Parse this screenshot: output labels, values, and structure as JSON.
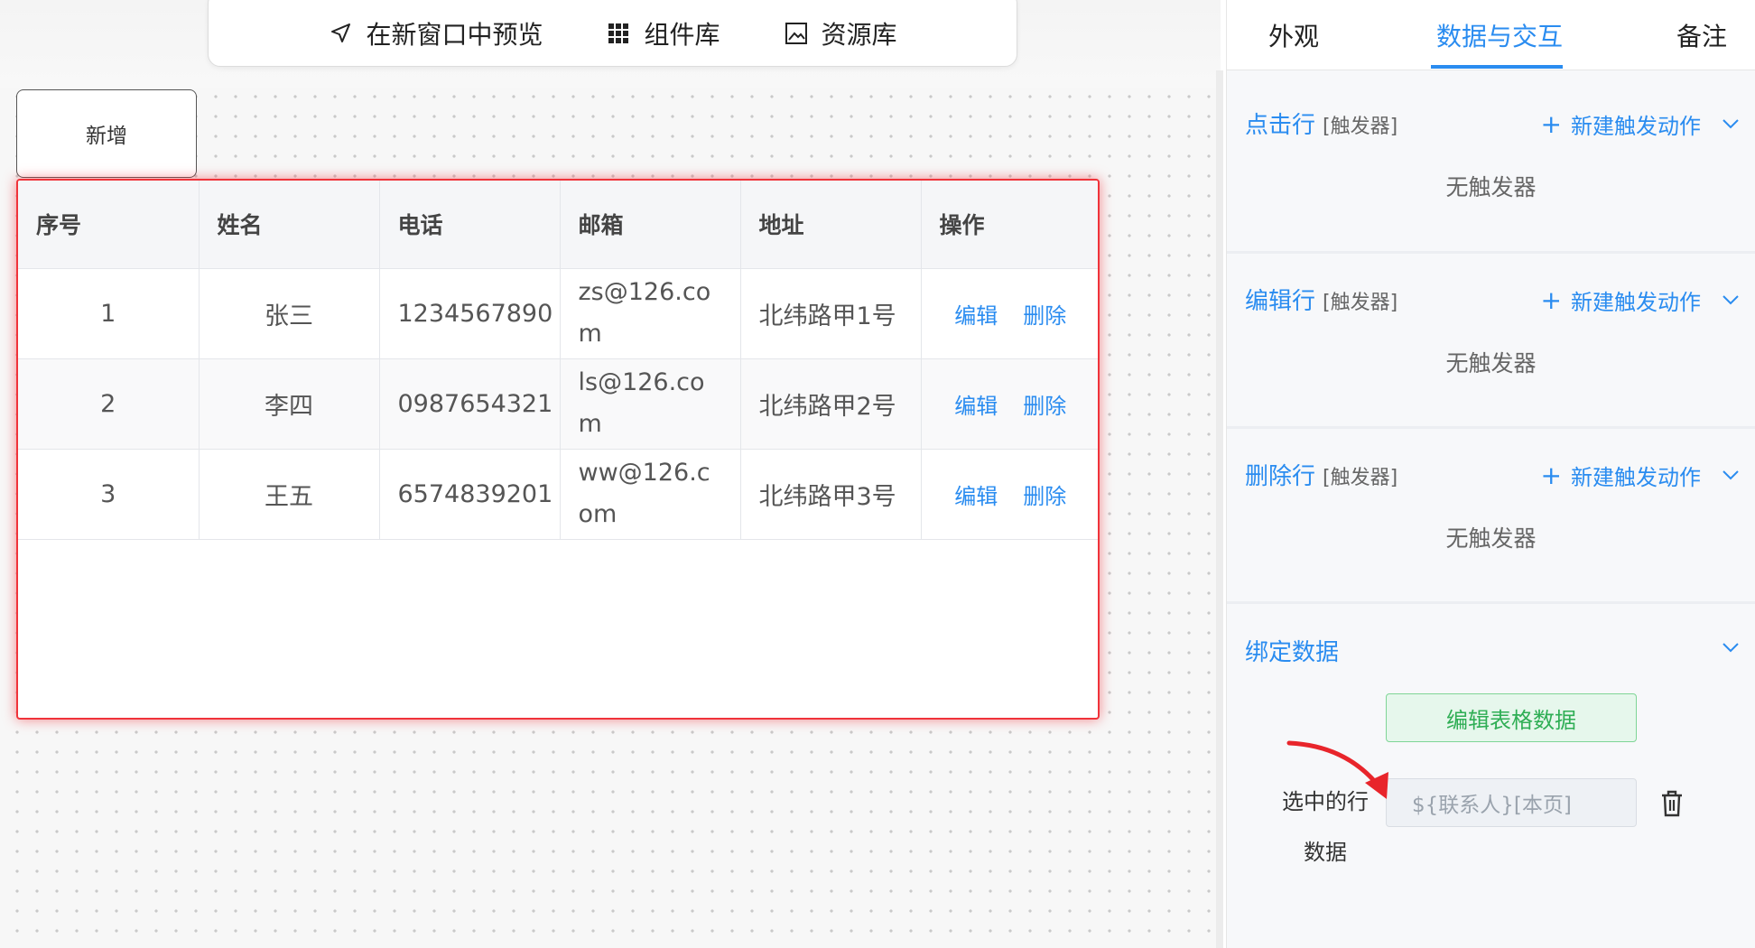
{
  "toolbar": {
    "preview_label": "在新窗口中预览",
    "components_label": "组件库",
    "assets_label": "资源库"
  },
  "add_button_label": "新增",
  "table": {
    "headers": [
      "序号",
      "姓名",
      "电话",
      "邮箱",
      "地址",
      "操作"
    ],
    "rows": [
      {
        "index": "1",
        "name": "张三",
        "phone": "1234567890",
        "email": "zs@126.com",
        "address": "北纬路甲1号"
      },
      {
        "index": "2",
        "name": "李四",
        "phone": "0987654321",
        "email": "ls@126.com",
        "address": "北纬路甲2号"
      },
      {
        "index": "3",
        "name": "王五",
        "phone": "6574839201",
        "email": "ww@126.com",
        "address": "北纬路甲3号"
      }
    ],
    "edit_label": "编辑",
    "delete_label": "删除"
  },
  "panel": {
    "tabs": [
      {
        "label": "外观",
        "active": false
      },
      {
        "label": "数据与交互",
        "active": true
      },
      {
        "label": "备注",
        "active": false
      }
    ],
    "sections": [
      {
        "title": "点击行",
        "subtitle": "[触发器]",
        "action": "新建触发动作",
        "empty": "无触发器"
      },
      {
        "title": "编辑行",
        "subtitle": "[触发器]",
        "action": "新建触发动作",
        "empty": "无触发器"
      },
      {
        "title": "删除行",
        "subtitle": "[触发器]",
        "action": "新建触发动作",
        "empty": "无触发器"
      }
    ],
    "bind": {
      "title": "绑定数据",
      "edit_button": "编辑表格数据",
      "selected_row_label_line1": "选中的行",
      "selected_row_label_line2": "数据",
      "selected_row_value": "${联系人}[本页]"
    }
  },
  "colors": {
    "accent": "#2a8cf0",
    "selection_border": "#f0333a",
    "success": "#2fae55",
    "arrow": "#e8252b"
  }
}
